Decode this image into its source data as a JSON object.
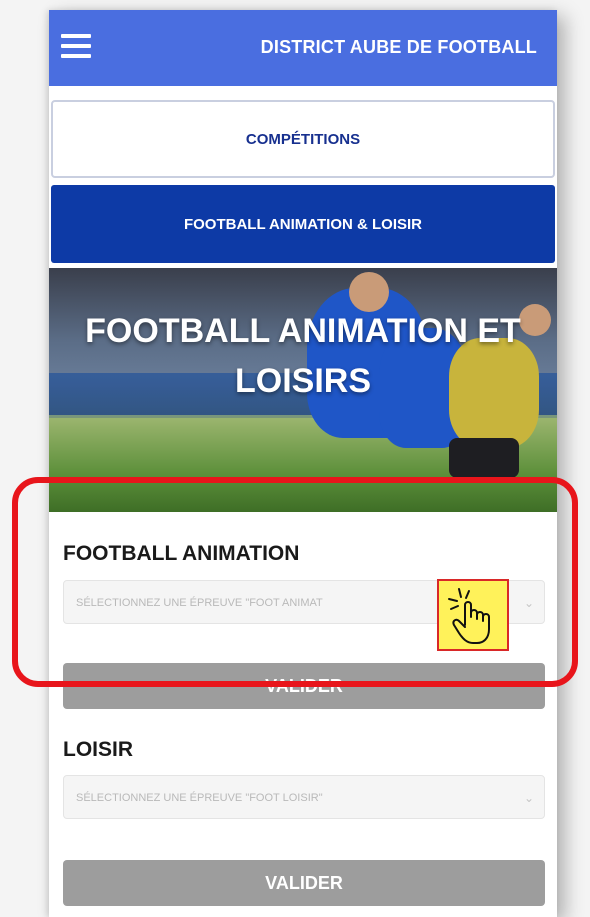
{
  "header": {
    "title": "DISTRICT AUBE DE FOOTBALL",
    "menu_icon": "hamburger-menu-icon",
    "color": "#4a6ee0"
  },
  "tabs": [
    {
      "label": "COMPÉTITIONS",
      "active": false
    },
    {
      "label": "FOOTBALL ANIMATION & LOISIR",
      "active": true,
      "color": "#0d3aa6"
    }
  ],
  "hero": {
    "title_line1": "FOOTBALL ANIMATION ET",
    "title_line2": "LOISIRS"
  },
  "animation": {
    "title": "FOOTBALL ANIMATION",
    "select_placeholder": "SÉLECTIONNEZ UNE ÉPREUVE \"FOOT ANIMAT",
    "submit_label": "VALIDER"
  },
  "loisir": {
    "title": "LOISIR",
    "select_placeholder": "SÉLECTIONNEZ UNE ÉPREUVE \"FOOT LOISIR\"",
    "submit_label": "VALIDER"
  },
  "annotation": {
    "highlight_color": "#e8151b",
    "cursor_icon": "hand-pointer-click-icon"
  }
}
